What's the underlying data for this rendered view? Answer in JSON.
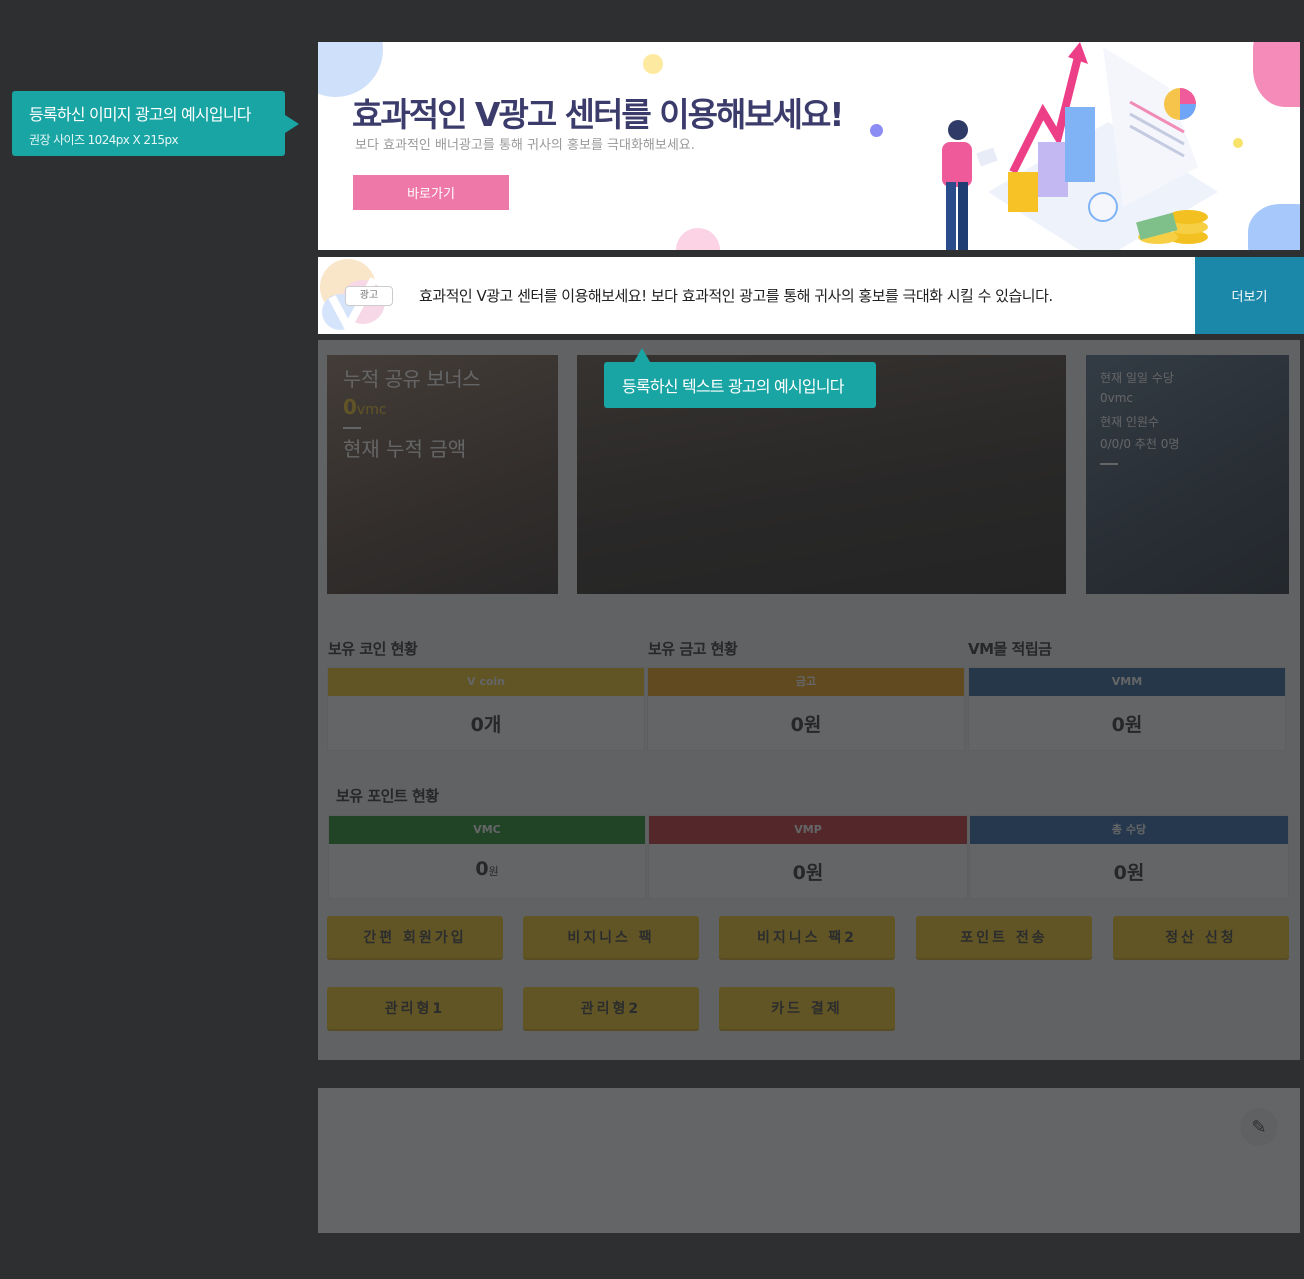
{
  "tooltips": {
    "image_ad": {
      "title": "등록하신 이미지 광고의 예시입니다",
      "size_hint": "권장 사이즈 1024px X 215px"
    },
    "text_ad": "등록하신 텍스트 광고의 예시입니다"
  },
  "banner": {
    "headline": "효과적인 V광고 센터를 이용해보세요!",
    "subtitle": "보다 효과적인 배너광고를 통해 귀사의 홍보를 극대화해보세요.",
    "button": "바로가기"
  },
  "text_ad": {
    "tag": "광고",
    "message": "효과적인 V광고 센터를 이용해보세요! 보다 효과적인 광고를 통해 귀사의 홍보를 극대화 시킬 수 있습니다.",
    "more_button": "더보기"
  },
  "cards": {
    "share_bonus": {
      "title": "누적 공유 보너스",
      "value": "0",
      "unit": "vmc",
      "subtitle": "현재 누적 금액"
    },
    "daily": {
      "line1": "현재 일일 수당",
      "line2": "0vmc",
      "line3": "현재 인원수",
      "line4": "0/0/0 추천 0명"
    }
  },
  "holdings": {
    "coin_label": "보유 코인 현황",
    "gold_label": "보유 금고 현황",
    "vm_label": "VM몰 적립금",
    "coin": {
      "header": "V coin",
      "value": "0개"
    },
    "gold": {
      "header": "금고",
      "value": "0원"
    },
    "vm": {
      "header": "VMM",
      "value": "0원"
    }
  },
  "points": {
    "label": "보유 포인트 현황",
    "vmc": {
      "header": "VMC",
      "value": "0",
      "unit": "원"
    },
    "vmp": {
      "header": "VMP",
      "value": "0원"
    },
    "total": {
      "header": "총 수당",
      "value": "0원"
    }
  },
  "buttons": {
    "b1": "간편 회원가입",
    "b2": "비지니스 팩",
    "b3": "비지니스 팩2",
    "b4": "포인트 전송",
    "b5": "정산 신청",
    "b6": "관리형1",
    "b7": "관리형2",
    "b8": "카드 결제"
  },
  "colors": {
    "tooltip": "#1aa5a5",
    "button_yellow": "#f3c617",
    "banner_button": "#ee79a8",
    "more_button": "#1b87a9",
    "vcoin": "#f3c617",
    "gold": "#f59d00",
    "vmm": "#1f5a94",
    "vmc": "#108a1e",
    "vmp": "#c6262e",
    "total": "#1f5ea6"
  },
  "icons": {
    "edit": "pencil-icon"
  }
}
